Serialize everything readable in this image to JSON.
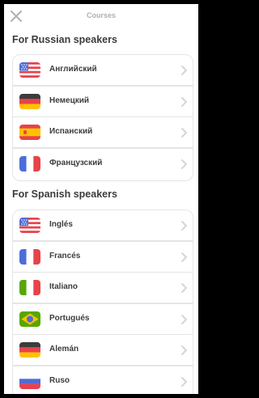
{
  "header": {
    "title": "Courses",
    "close_icon": "close-icon"
  },
  "sections": [
    {
      "title": "For Russian speakers",
      "courses": [
        {
          "label": "Английский",
          "flag": "us-flag"
        },
        {
          "label": "Немецкий",
          "flag": "germany-flag"
        },
        {
          "label": "Испанский",
          "flag": "spain-flag"
        },
        {
          "label": "Французский",
          "flag": "france-flag"
        }
      ]
    },
    {
      "title": "For Spanish speakers",
      "courses": [
        {
          "label": "Inglés",
          "flag": "us-flag"
        },
        {
          "label": "Francés",
          "flag": "france-flag"
        },
        {
          "label": "Italiano",
          "flag": "italy-flag"
        },
        {
          "label": "Portugués",
          "flag": "brazil-flag"
        },
        {
          "label": "Alemán",
          "flag": "germany-flag"
        },
        {
          "label": "Ruso",
          "flag": "russia-flag"
        }
      ]
    }
  ],
  "colors": {
    "text": "#3c3c3c",
    "muted": "#afafaf",
    "border": "#e5e5e5",
    "chevron": "#d6d6d6"
  }
}
